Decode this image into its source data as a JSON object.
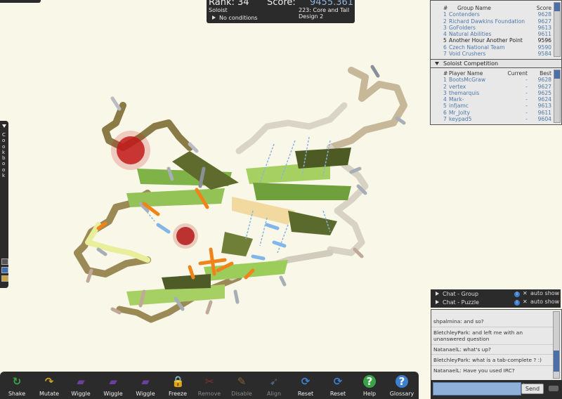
{
  "score_panel": {
    "rank_label": "Rank: 34",
    "score_label": "Score:",
    "score_value": "9455.361",
    "mode": "Soloist",
    "puzzle": "223: Core and Tail Design 2",
    "conditions": "No conditions"
  },
  "group_panel": {
    "headers": {
      "num": "#",
      "name": "Group Name",
      "score": "Score"
    },
    "rows": [
      {
        "num": "1",
        "name": "Contenders",
        "score": "9628"
      },
      {
        "num": "2",
        "name": "Richard Dawkins Foundation",
        "score": "9627"
      },
      {
        "num": "3",
        "name": "GoFolders",
        "score": "9613"
      },
      {
        "num": "4",
        "name": "Natural Abilities",
        "score": "9611"
      },
      {
        "num": "5",
        "name": "Another Hour Another Point",
        "score": "9596"
      },
      {
        "num": "6",
        "name": "Czech National Team",
        "score": "9590"
      },
      {
        "num": "7",
        "name": "Void Crushers",
        "score": "9584"
      }
    ]
  },
  "soloist_panel": {
    "title": "Soloist Competition",
    "headers": {
      "num": "#",
      "name": "Player Name",
      "current": "Current",
      "best": "Best"
    },
    "rows": [
      {
        "num": "1",
        "name": "BootsMcGraw",
        "current": "-",
        "best": "9628"
      },
      {
        "num": "2",
        "name": "vertex",
        "current": "-",
        "best": "9627"
      },
      {
        "num": "3",
        "name": "themarquis",
        "current": "-",
        "best": "9625"
      },
      {
        "num": "4",
        "name": "Mark-",
        "current": "-",
        "best": "9624"
      },
      {
        "num": "5",
        "name": "infjamc",
        "current": "-",
        "best": "9613"
      },
      {
        "num": "6",
        "name": "Mr_Jolty",
        "current": "-",
        "best": "9611"
      },
      {
        "num": "7",
        "name": "keypad5",
        "current": "-",
        "best": "9604"
      }
    ]
  },
  "cookbook": {
    "label": "Cookbook"
  },
  "chat": {
    "tabs": [
      {
        "label": "Chat - Group",
        "auto": "auto show"
      },
      {
        "label": "Chat - Puzzle",
        "auto": "auto show"
      }
    ],
    "messages": [
      {
        "user": "shpalmina",
        "text": ": and so?"
      },
      {
        "user": "BletchleyPark",
        "text": ": and left me with an unanswered question"
      },
      {
        "user": "NatanaelL",
        "text": ": what's up?"
      },
      {
        "user": "BletchleyPark",
        "text": ": what is a tab-complete ? :)"
      },
      {
        "user": "NatanaelL",
        "text": ": Have you used IRC?"
      }
    ],
    "input_value": "",
    "send_label": "Send"
  },
  "toolbar": {
    "tools": [
      {
        "label": "Shake",
        "icon": "shake-icon"
      },
      {
        "label": "Mutate",
        "icon": "mutate-icon"
      },
      {
        "label": "Wiggle",
        "icon": "wiggle-icon"
      },
      {
        "label": "Wiggle",
        "icon": "wiggle-backbone-icon"
      },
      {
        "label": "Wiggle",
        "icon": "wiggle-sidechains-icon"
      },
      {
        "label": "Freeze",
        "icon": "freeze-icon"
      },
      {
        "label": "Remove",
        "icon": "remove-icon"
      },
      {
        "label": "Disable",
        "icon": "disable-icon"
      },
      {
        "label": "Align",
        "icon": "align-icon"
      },
      {
        "label": "Reset",
        "icon": "reset-icon"
      },
      {
        "label": "Reset",
        "icon": "reset-puzzle-icon"
      },
      {
        "label": "Help",
        "icon": "help-icon"
      },
      {
        "label": "Glossary",
        "icon": "glossary-icon"
      }
    ]
  },
  "colors": {
    "background": "#f9f8e8",
    "panel_dark": "#2b2b2b",
    "link_blue": "#4d78a8",
    "score_value": "#8fb3d9"
  }
}
